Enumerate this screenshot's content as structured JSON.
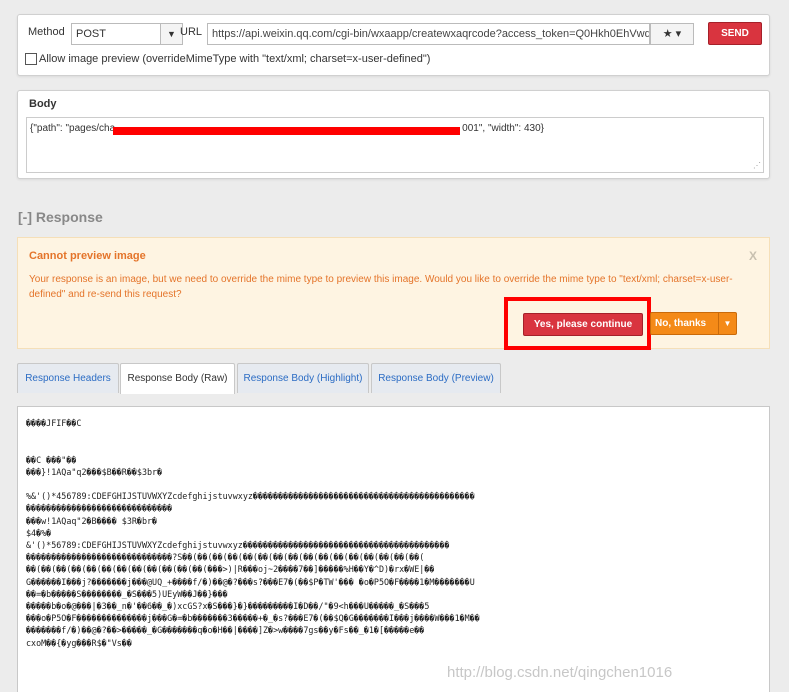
{
  "request": {
    "method_label": "Method",
    "method_value": "POST",
    "url_label": "URL",
    "url_value": "https://api.weixin.qq.com/cgi-bin/wxaapp/createwxaqrcode?access_token=Q0Hkh0EhVwdvFte",
    "url_button": "★ ▾",
    "send_label": "SEND",
    "preview_label": "Allow image preview (overrideMimeType with \"text/xml; charset=x-user-defined\")"
  },
  "body": {
    "title": "Body",
    "text_start": "{\"path\": \"pages/cha",
    "text_end": "001\", \"width\": 430}",
    "redaction_color": "#ff0000"
  },
  "response": {
    "title": "[-] Response"
  },
  "warning": {
    "title": "Cannot preview image",
    "close": "X",
    "text": "Your response is an image, but we need to override the mime type to preview this image. Would you like to override the mime type to \"text/xml; charset=x-user-defined\" and re-send this request?",
    "yes_label": "Yes, please continue",
    "no_label": "No, thanks",
    "accent": "#e4742a"
  },
  "tabs": [
    {
      "label": "Response Headers"
    },
    {
      "label": "Response Body (Raw)"
    },
    {
      "label": "Response Body (Highlight)"
    },
    {
      "label": "Response Body (Preview)"
    }
  ],
  "response_body": {
    "lines": [
      "����JFIF��C",
      "",
      "",
      "��C          ���\"��",
      "���}!1AQa\"q2���$B��R��$3br�",
      "",
      "%&'()*456789:CDEFGHIJSTUVWXYZcdefghijstuvwxyz��������������������������������������������",
      "�����������������������������",
      "���w!1AQaq\"2�B����  $3R�br�",
      "$4�%�",
      "&'()*56789:CDEFGHIJSTUVWXYZcdefghijstuvwxyz�����������������������������������������",
      "�����������������������������?S��(��(��(��(��(��(��(��(��(��(��(��(��(��(��(��(",
      "��(��(��(��(��(��(��(��(��(��(��(��(���>)|R���oj~2����7��]�����%H��Y�^D)�rx�WE|��",
      "G������I���j?�������j���@UQ_+����f/�)��@�?���s?���E7�(��$P�TW'��� �o�P5O�F����1�M�������U",
      "��=�b�����S��������_�S���5)UEyW��J��}���",
      "�����b�o�@���|�3��_n�'��6��_�)xcGS?x�S���}�}���������I�D��/\"�9<h���U�����_�S���5",
      "���o�P5O�F��������������j���G�=�b�������3�����+�_�s?���E7�(��$Q�G�������I���j����W���1�M��",
      "�������f/�)��@�?��>�����_�G�������q�o�H��|����]Z�>w����7gs��y�Fs��_�1�[�����e��",
      "cxoM��{�yg���R$�\"Vs��"
    ]
  },
  "watermark": "http://blog.csdn.net/qingchen1016"
}
